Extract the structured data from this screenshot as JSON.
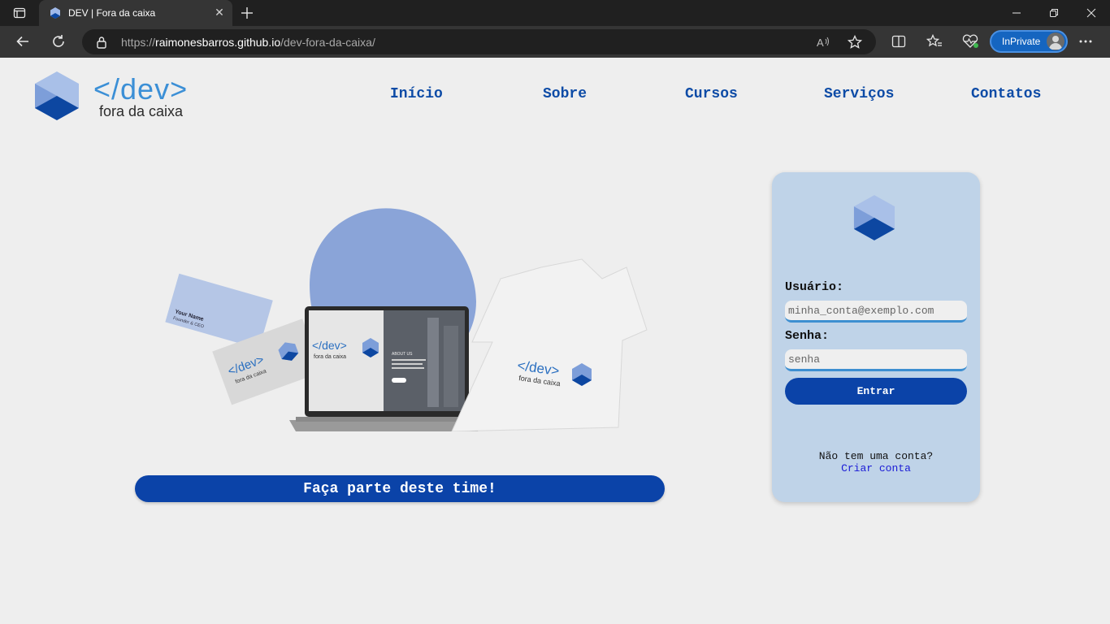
{
  "browser": {
    "tab_title": "DEV | Fora da caixa",
    "url_prefix": "https://",
    "url_host": "raimonesbarros.github.io",
    "url_path": "/dev-fora-da-caixa/",
    "inprivate_label": "InPrivate"
  },
  "logo": {
    "code_text": "</dev>",
    "subtitle": "fora da caixa"
  },
  "nav": {
    "items": [
      "Início",
      "Sobre",
      "Cursos",
      "Serviços",
      "Contatos"
    ]
  },
  "hero": {
    "cta_label": "Faça parte deste time!",
    "mockup": {
      "card_name": "Your Name",
      "card_role": "Founder & CEO",
      "card_logo_code": "</dev>",
      "card_logo_sub": "fora da caixa",
      "laptop_logo_code": "</dev>",
      "laptop_logo_sub": "fora da caixa",
      "laptop_section": "ABOUT US",
      "shirt_logo_code": "</dev>",
      "shirt_logo_sub": "fora da caixa"
    }
  },
  "login": {
    "user_label": "Usuário:",
    "user_placeholder": "minha_conta@exemplo.com",
    "password_label": "Senha:",
    "password_placeholder": "senha",
    "submit_label": "Entrar",
    "no_account_text": "Não tem uma conta?",
    "create_account_link": "Criar conta"
  },
  "colors": {
    "brand_blue": "#0b43a8",
    "accent_light_blue": "#3b8fd6",
    "card_background": "#bfd3e8",
    "page_background": "#eeeeee"
  }
}
